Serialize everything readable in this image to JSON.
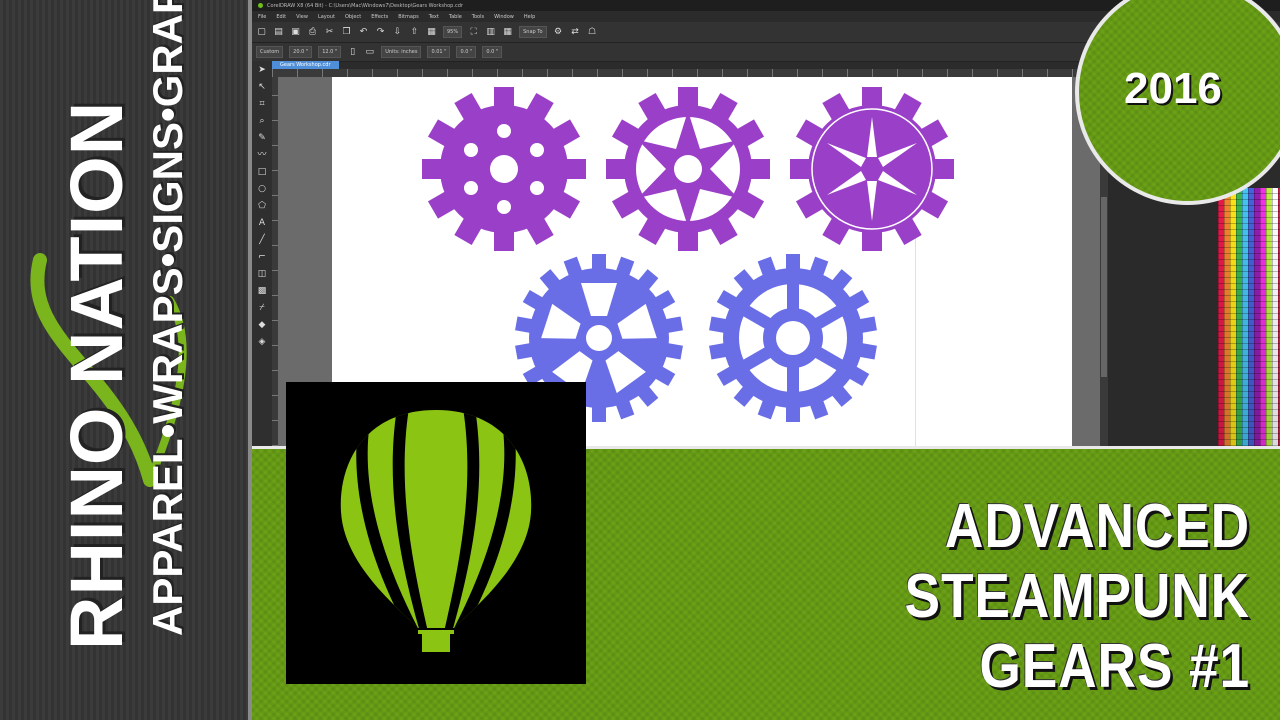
{
  "brand": {
    "name": "RHINO NATION",
    "tagline": "APPAREL•WRAPS•SIGNS•GRAPHICS"
  },
  "app": {
    "title": "CorelDRAW X8 (64 Bit) - C:\\Users\\Mac\\Windows7\\Desktop\\Gears Workshop.cdr",
    "menu": [
      "File",
      "Edit",
      "View",
      "Layout",
      "Object",
      "Effects",
      "Bitmaps",
      "Text",
      "Table",
      "Tools",
      "Window",
      "Help"
    ],
    "zoom": "95%",
    "snap_label": "Snap To",
    "preset": "Custom",
    "width": "20.0 \"",
    "height": "12.0 \"",
    "units": "Units: inches",
    "nudge": "0.01 \"",
    "dup_x": "0.0 \"",
    "dup_y": "0.0 \"",
    "tab_label": "Gears Workshop.cdr"
  },
  "headline": {
    "line1": "ADVANCED STEAMPUNK",
    "line2": "GEARS #1"
  },
  "year": "2016",
  "colors": {
    "purple": "#9a3fc7",
    "periwinkle": "#6a6ee6",
    "green": "#6aa116",
    "logo_green": "#8cc413"
  }
}
